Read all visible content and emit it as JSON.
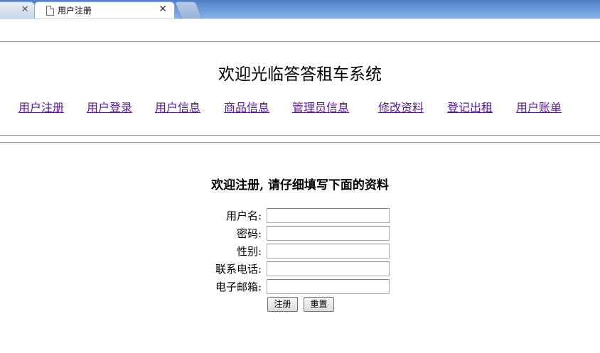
{
  "browser": {
    "tabs": [
      {
        "label": "",
        "active": false
      },
      {
        "label": "用户注册",
        "active": true
      }
    ],
    "close_glyph": "✕"
  },
  "page": {
    "site_title": "欢迎光临答答租车系统",
    "nav": [
      {
        "label": "用户注册"
      },
      {
        "label": "用户登录"
      },
      {
        "label": "用户信息"
      },
      {
        "label": "商品信息"
      },
      {
        "label": "管理员信息"
      },
      {
        "label": "修改资料"
      },
      {
        "label": "登记出租"
      },
      {
        "label": "用户账单"
      }
    ],
    "form": {
      "heading": "欢迎注册, 请仔细填写下面的资料",
      "fields": [
        {
          "label": "用户名:",
          "value": ""
        },
        {
          "label": "密码:",
          "value": ""
        },
        {
          "label": "性别:",
          "value": ""
        },
        {
          "label": "联系电话:",
          "value": ""
        },
        {
          "label": "电子邮箱:",
          "value": ""
        }
      ],
      "submit_label": "注册",
      "reset_label": "重置"
    }
  },
  "colors": {
    "link_visited": "#551a8b",
    "tabstrip": "#6a98d8"
  }
}
